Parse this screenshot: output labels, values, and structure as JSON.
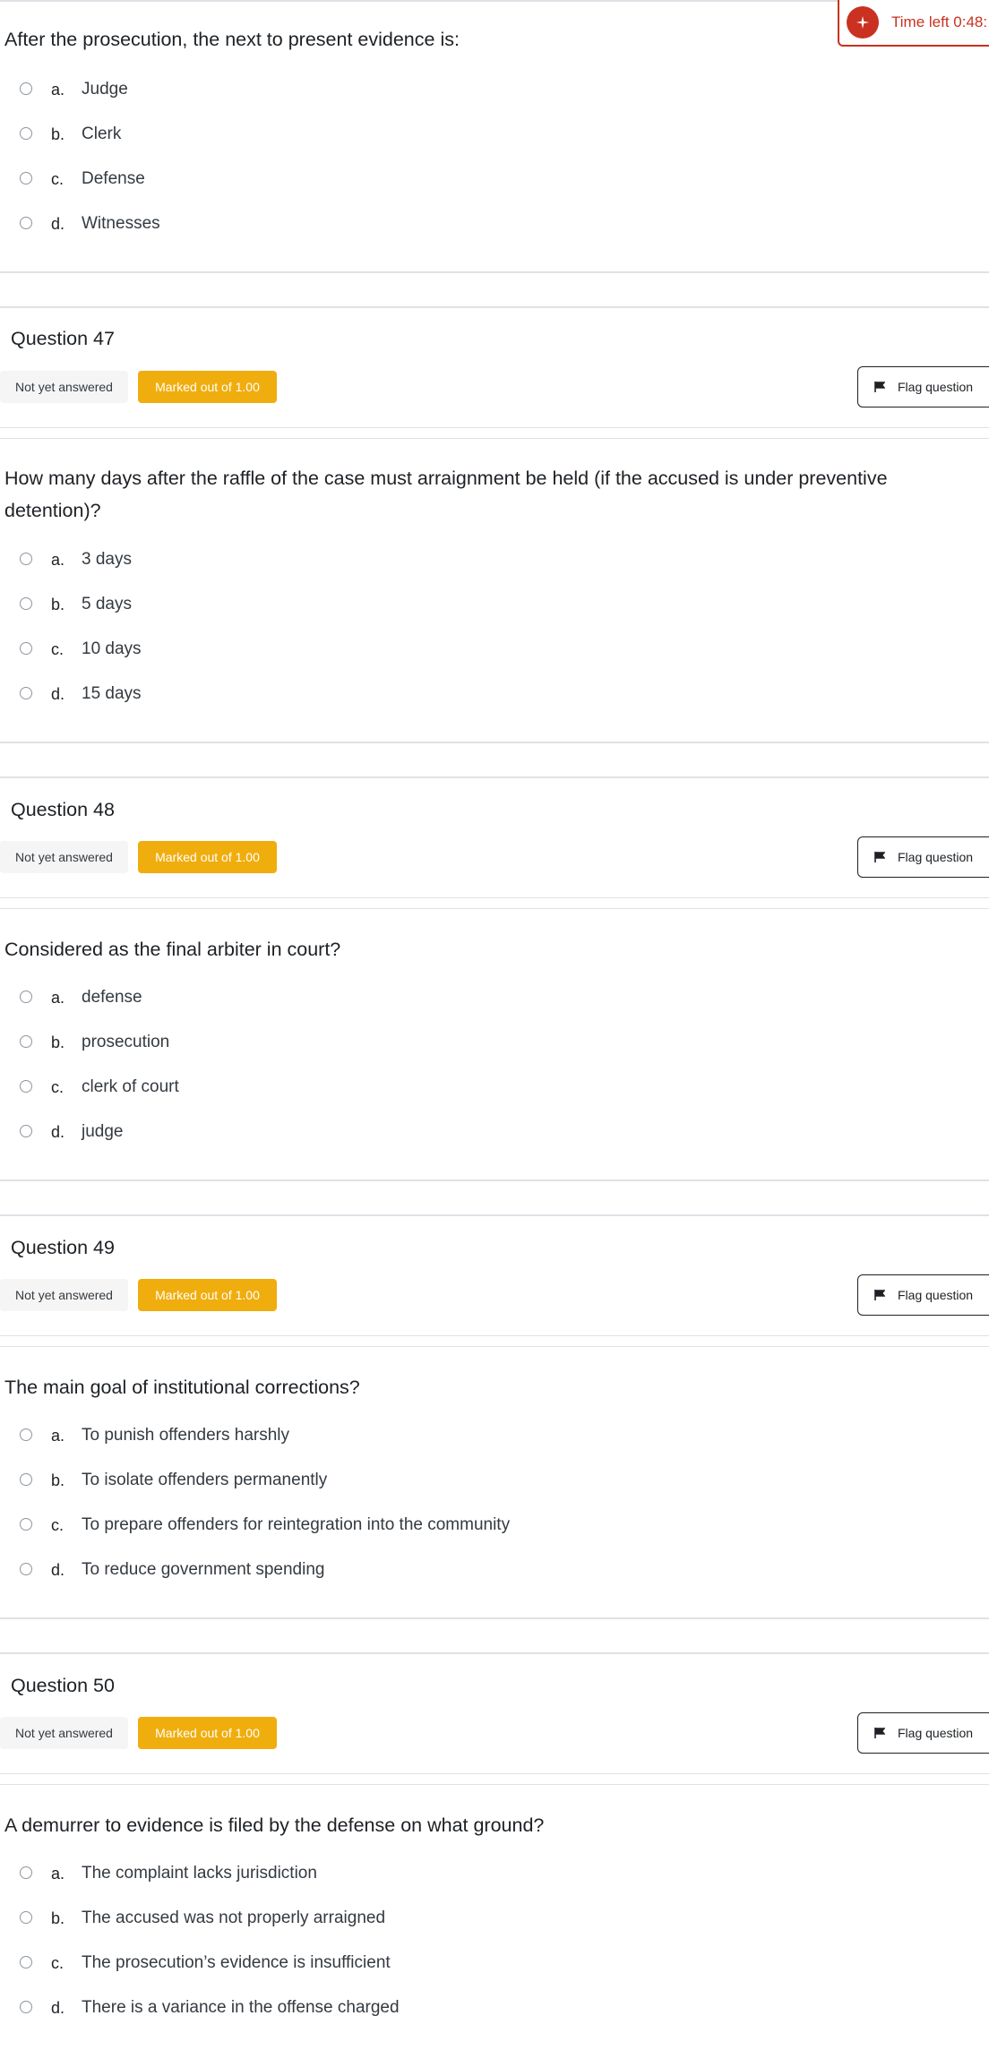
{
  "timer": {
    "label": "Time left 0:48:"
  },
  "intro_question": {
    "text": "After the prosecution, the next to present evidence is:",
    "options": [
      {
        "letter": "a.",
        "text": "Judge"
      },
      {
        "letter": "b.",
        "text": "Clerk"
      },
      {
        "letter": "c.",
        "text": "Defense"
      },
      {
        "letter": "d.",
        "text": "Witnesses"
      }
    ]
  },
  "questions": [
    {
      "title": "Question 47",
      "state": "Not yet answered",
      "mark": "Marked out of 1.00",
      "flag": "Flag question",
      "text": "How many days after the raffle of the case must arraignment be held (if the accused is under preventive detention)?",
      "options": [
        {
          "letter": "a.",
          "text": "3 days"
        },
        {
          "letter": "b.",
          "text": "5 days"
        },
        {
          "letter": "c.",
          "text": "10 days"
        },
        {
          "letter": "d.",
          "text": "15 days"
        }
      ]
    },
    {
      "title": "Question 48",
      "state": "Not yet answered",
      "mark": "Marked out of 1.00",
      "flag": "Flag question",
      "text": "Considered as the final arbiter in court?",
      "options": [
        {
          "letter": "a.",
          "text": "defense"
        },
        {
          "letter": "b.",
          "text": "prosecution"
        },
        {
          "letter": "c.",
          "text": "clerk of court"
        },
        {
          "letter": "d.",
          "text": "judge"
        }
      ]
    },
    {
      "title": "Question 49",
      "state": "Not yet answered",
      "mark": "Marked out of 1.00",
      "flag": "Flag question",
      "text": "The main goal of institutional corrections?",
      "options": [
        {
          "letter": "a.",
          "text": "To punish offenders harshly"
        },
        {
          "letter": "b.",
          "text": "To isolate offenders permanently"
        },
        {
          "letter": "c.",
          "text": "To prepare offenders for reintegration into the community"
        },
        {
          "letter": "d.",
          "text": "To reduce government spending"
        }
      ]
    },
    {
      "title": "Question 50",
      "state": "Not yet answered",
      "mark": "Marked out of 1.00",
      "flag": "Flag question",
      "text": "A demurrer to evidence is filed by the defense on what ground?",
      "options": [
        {
          "letter": "a.",
          "text": "The complaint lacks jurisdiction"
        },
        {
          "letter": "b.",
          "text": "The accused was not properly arraigned"
        },
        {
          "letter": "c.",
          "text": "The prosecution’s evidence is insufficient"
        },
        {
          "letter": "d.",
          "text": "There is a variance in the offense charged"
        }
      ]
    }
  ],
  "colors": {
    "accent_red": "#ca3120",
    "badge_yellow": "#f0ad0e",
    "badge_grey": "#f5f5f5"
  },
  "icons": {
    "timer": "timer-icon",
    "flag": "flag-icon"
  }
}
